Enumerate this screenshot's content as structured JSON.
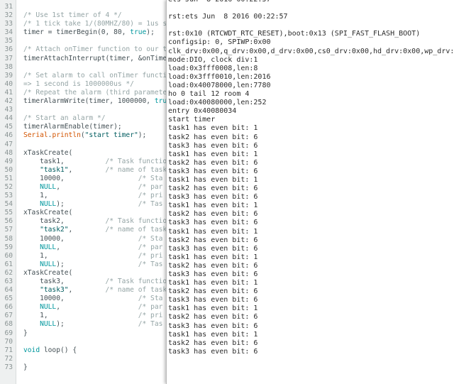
{
  "editor": {
    "lines": [
      {
        "n": "31",
        "tokens": []
      },
      {
        "n": "32",
        "tokens": [
          {
            "t": "/* Use 1st timer of 4 */",
            "c": "comment"
          }
        ]
      },
      {
        "n": "33",
        "tokens": [
          {
            "t": "/* 1 tick take 1/(80MHZ/80) = 1us so",
            "c": "comment"
          }
        ]
      },
      {
        "n": "34",
        "tokens": [
          {
            "t": "timer = timerBegin(0, 80, ",
            "c": "plain"
          },
          {
            "t": "true",
            "c": "const"
          },
          {
            "t": ");",
            "c": "plain"
          }
        ]
      },
      {
        "n": "35",
        "tokens": []
      },
      {
        "n": "36",
        "tokens": [
          {
            "t": "/* Attach onTimer function to our ti",
            "c": "comment"
          }
        ]
      },
      {
        "n": "37",
        "tokens": [
          {
            "t": "timerAttachInterrupt(timer, &onTimer",
            "c": "plain"
          }
        ]
      },
      {
        "n": "38",
        "tokens": []
      },
      {
        "n": "39",
        "tokens": [
          {
            "t": "/* Set alarm to call onTimer functio",
            "c": "comment"
          }
        ]
      },
      {
        "n": "40",
        "tokens": [
          {
            "t": "=> 1 second is 1000000us */",
            "c": "comment"
          }
        ]
      },
      {
        "n": "41",
        "tokens": [
          {
            "t": "/* Repeat the alarm (third parameter",
            "c": "comment"
          }
        ]
      },
      {
        "n": "42",
        "tokens": [
          {
            "t": "timerAlarmWrite(timer, 1000000, ",
            "c": "plain"
          },
          {
            "t": "true",
            "c": "const"
          }
        ]
      },
      {
        "n": "43",
        "tokens": []
      },
      {
        "n": "44",
        "tokens": [
          {
            "t": "/* Start an alarm */",
            "c": "comment"
          }
        ]
      },
      {
        "n": "45",
        "tokens": [
          {
            "t": "timerAlarmEnable(timer);",
            "c": "plain"
          }
        ]
      },
      {
        "n": "46",
        "tokens": [
          {
            "t": "Serial",
            "c": "builtin"
          },
          {
            "t": ".",
            "c": "plain"
          },
          {
            "t": "println",
            "c": "builtin"
          },
          {
            "t": "(",
            "c": "plain"
          },
          {
            "t": "\"start timer\"",
            "c": "string"
          },
          {
            "t": ");",
            "c": "plain"
          }
        ]
      },
      {
        "n": "47",
        "tokens": []
      },
      {
        "n": "48",
        "tokens": [
          {
            "t": "xTaskCreate(",
            "c": "plain"
          }
        ]
      },
      {
        "n": "49",
        "tokens": [
          {
            "t": "    task1,          ",
            "c": "plain"
          },
          {
            "t": "/* Task functio",
            "c": "comment"
          }
        ]
      },
      {
        "n": "50",
        "tokens": [
          {
            "t": "    ",
            "c": "plain"
          },
          {
            "t": "\"task1\"",
            "c": "string"
          },
          {
            "t": ",        ",
            "c": "plain"
          },
          {
            "t": "/* name of task.",
            "c": "comment"
          }
        ]
      },
      {
        "n": "51",
        "tokens": [
          {
            "t": "    10000,                  ",
            "c": "plain"
          },
          {
            "t": "/* Sta",
            "c": "comment"
          }
        ]
      },
      {
        "n": "52",
        "tokens": [
          {
            "t": "    ",
            "c": "plain"
          },
          {
            "t": "NULL",
            "c": "const"
          },
          {
            "t": ",                   ",
            "c": "plain"
          },
          {
            "t": "/* par",
            "c": "comment"
          }
        ]
      },
      {
        "n": "53",
        "tokens": [
          {
            "t": "    1,                      ",
            "c": "plain"
          },
          {
            "t": "/* pri",
            "c": "comment"
          }
        ]
      },
      {
        "n": "54",
        "tokens": [
          {
            "t": "    ",
            "c": "plain"
          },
          {
            "t": "NULL",
            "c": "const"
          },
          {
            "t": ");                  ",
            "c": "plain"
          },
          {
            "t": "/* Tas",
            "c": "comment"
          }
        ]
      },
      {
        "n": "55",
        "tokens": [
          {
            "t": "xTaskCreate(",
            "c": "plain"
          }
        ]
      },
      {
        "n": "56",
        "tokens": [
          {
            "t": "    task2,          ",
            "c": "plain"
          },
          {
            "t": "/* Task functio",
            "c": "comment"
          }
        ]
      },
      {
        "n": "57",
        "tokens": [
          {
            "t": "    ",
            "c": "plain"
          },
          {
            "t": "\"task2\"",
            "c": "string"
          },
          {
            "t": ",        ",
            "c": "plain"
          },
          {
            "t": "/* name of task.",
            "c": "comment"
          }
        ]
      },
      {
        "n": "58",
        "tokens": [
          {
            "t": "    10000,                  ",
            "c": "plain"
          },
          {
            "t": "/* Sta",
            "c": "comment"
          }
        ]
      },
      {
        "n": "59",
        "tokens": [
          {
            "t": "    ",
            "c": "plain"
          },
          {
            "t": "NULL",
            "c": "const"
          },
          {
            "t": ",                   ",
            "c": "plain"
          },
          {
            "t": "/* par",
            "c": "comment"
          }
        ]
      },
      {
        "n": "60",
        "tokens": [
          {
            "t": "    1,                      ",
            "c": "plain"
          },
          {
            "t": "/* pri",
            "c": "comment"
          }
        ]
      },
      {
        "n": "61",
        "tokens": [
          {
            "t": "    ",
            "c": "plain"
          },
          {
            "t": "NULL",
            "c": "const"
          },
          {
            "t": ");                  ",
            "c": "plain"
          },
          {
            "t": "/* Tas",
            "c": "comment"
          }
        ]
      },
      {
        "n": "62",
        "tokens": [
          {
            "t": "xTaskCreate(",
            "c": "plain"
          }
        ]
      },
      {
        "n": "63",
        "tokens": [
          {
            "t": "    task3,          ",
            "c": "plain"
          },
          {
            "t": "/* Task functio",
            "c": "comment"
          }
        ]
      },
      {
        "n": "64",
        "tokens": [
          {
            "t": "    ",
            "c": "plain"
          },
          {
            "t": "\"task3\"",
            "c": "string"
          },
          {
            "t": ",        ",
            "c": "plain"
          },
          {
            "t": "/* name of task.",
            "c": "comment"
          }
        ]
      },
      {
        "n": "65",
        "tokens": [
          {
            "t": "    10000,                  ",
            "c": "plain"
          },
          {
            "t": "/* Sta",
            "c": "comment"
          }
        ]
      },
      {
        "n": "66",
        "tokens": [
          {
            "t": "    ",
            "c": "plain"
          },
          {
            "t": "NULL",
            "c": "const"
          },
          {
            "t": ",                   ",
            "c": "plain"
          },
          {
            "t": "/* par",
            "c": "comment"
          }
        ]
      },
      {
        "n": "67",
        "tokens": [
          {
            "t": "    1,                      ",
            "c": "plain"
          },
          {
            "t": "/* pri",
            "c": "comment"
          }
        ]
      },
      {
        "n": "68",
        "tokens": [
          {
            "t": "    ",
            "c": "plain"
          },
          {
            "t": "NULL",
            "c": "const"
          },
          {
            "t": ");                  ",
            "c": "plain"
          },
          {
            "t": "/* Tas",
            "c": "comment"
          }
        ]
      },
      {
        "n": "69",
        "tokens": [
          {
            "t": "}",
            "c": "plain"
          }
        ]
      },
      {
        "n": "70",
        "tokens": []
      },
      {
        "n": "71",
        "tokens": [
          {
            "t": "void",
            "c": "kw"
          },
          {
            "t": " loop() {",
            "c": "plain"
          }
        ]
      },
      {
        "n": "72",
        "tokens": []
      },
      {
        "n": "73",
        "tokens": [
          {
            "t": "}",
            "c": "plain"
          }
        ]
      }
    ]
  },
  "serial_monitor": {
    "lines": [
      "ets Jun  8 2016 00:22:57",
      "",
      "rst:ets Jun  8 2016 00:22:57",
      "",
      "rst:0x10 (RTCWDT_RTC_RESET),boot:0x13 (SPI_FAST_FLASH_BOOT)",
      "configsip: 0, SPIWP:0x00",
      "clk_drv:0x00,q_drv:0x00,d_drv:0x00,cs0_drv:0x00,hd_drv:0x00,wp_drv:0x00",
      "mode:DIO, clock div:1",
      "load:0x3fff0008,len:8",
      "load:0x3fff0010,len:2016",
      "load:0x40078000,len:7780",
      "ho 0 tail 12 room 4",
      "load:0x40080000,len:252",
      "entry 0x40080034",
      "start timer",
      "task1 has even bit: 1",
      "task2 has even bit: 6",
      "task3 has even bit: 6",
      "task1 has even bit: 1",
      "task2 has even bit: 6",
      "task3 has even bit: 6",
      "task1 has even bit: 1",
      "task2 has even bit: 6",
      "task3 has even bit: 6",
      "task1 has even bit: 1",
      "task2 has even bit: 6",
      "task3 has even bit: 6",
      "task1 has even bit: 1",
      "task2 has even bit: 6",
      "task3 has even bit: 6",
      "task1 has even bit: 1",
      "task2 has even bit: 6",
      "task3 has even bit: 6",
      "task1 has even bit: 1",
      "task2 has even bit: 6",
      "task3 has even bit: 6",
      "task1 has even bit: 1",
      "task2 has even bit: 6",
      "task3 has even bit: 6",
      "task1 has even bit: 1",
      "task2 has even bit: 6",
      "task3 has even bit: 6"
    ]
  }
}
